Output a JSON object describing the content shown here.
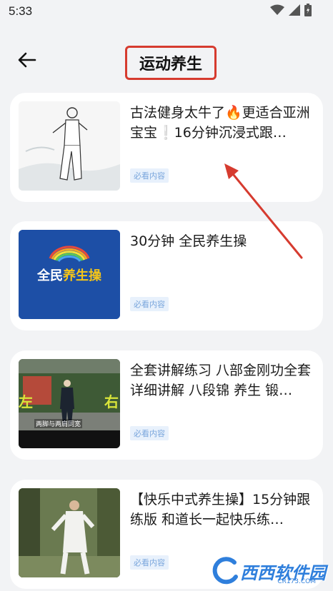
{
  "status": {
    "time": "5:33"
  },
  "header": {
    "title": "运动养生"
  },
  "items": [
    {
      "title": "古法健身太牛了🔥更适合亚洲宝宝❕16分钟沉浸式跟…",
      "tag": "必看内容"
    },
    {
      "title": "30分钟 全民养生操",
      "tag": "必看内容",
      "thumb_text_1": "全民",
      "thumb_text_2": "养生操"
    },
    {
      "title": "全套讲解练习 八部金刚功全套详细讲解 八段锦 养生 锻…",
      "tag": "必看内容",
      "thumb_caption": "两脚与两肩同宽",
      "thumb_side_left": "左",
      "thumb_side_right": "右"
    },
    {
      "title": "【快乐中式养生操】15分钟跟练版 和道长一起快乐练…",
      "tag": "必看内容"
    }
  ],
  "watermark": {
    "text": "西西软件园",
    "sub": "CR173.COM"
  },
  "colors": {
    "accent_red": "#d63b2f",
    "tag_text": "#7aa6dc",
    "tag_bg": "#e8f1fc",
    "card_bg": "#ffffff",
    "page_bg": "#f2f3f5"
  }
}
